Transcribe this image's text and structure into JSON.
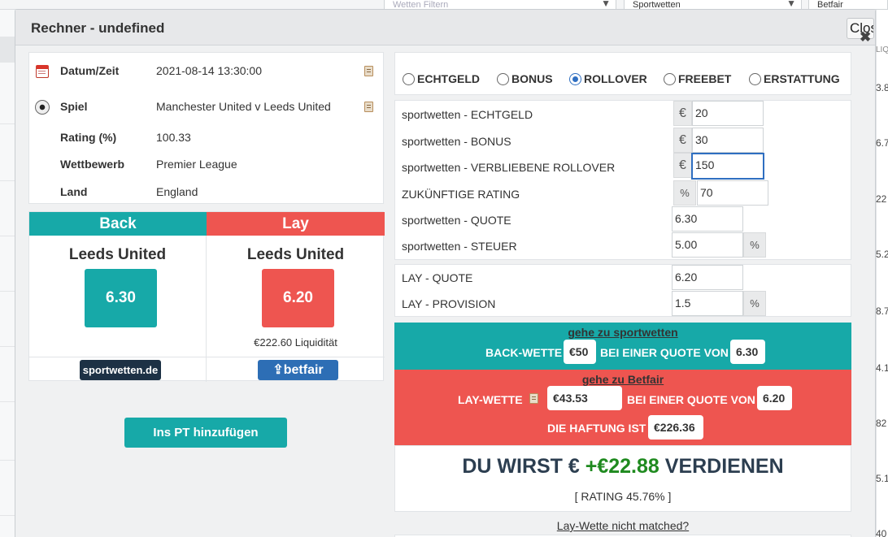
{
  "background": {
    "filter_placeholder": "Wetten Filtern",
    "sport_select": "Sportwetten",
    "right_select": "Betfair",
    "right_header": "LIQUI",
    "right_numbers": [
      "3.8",
      "6.7",
      "22",
      "5.2",
      "8.7",
      "4.1",
      "82",
      "5.1",
      "40"
    ]
  },
  "modal": {
    "title": "Rechner - undefined",
    "close_label": "Close"
  },
  "info": {
    "date_label": "Datum/Zeit",
    "date_value": "2021-08-14 13:30:00",
    "game_label": "Spiel",
    "game_value": "Manchester United v Leeds United",
    "rating_label": "Rating (%)",
    "rating_value": "100.33",
    "competition_label": "Wettbewerb",
    "competition_value": "Premier League",
    "country_label": "Land",
    "country_value": "England"
  },
  "back": {
    "header": "Back",
    "team": "Leeds United",
    "odds": "6.30",
    "bookmaker": "sportwetten.de"
  },
  "lay": {
    "header": "Lay",
    "team": "Leeds United",
    "odds": "6.20",
    "liquidity": "€222.60 Liquidität",
    "exchange": "betfair"
  },
  "add_button": "Ins PT hinzufügen",
  "bet_types": [
    {
      "label": "ECHTGELD",
      "selected": false
    },
    {
      "label": "BONUS",
      "selected": false
    },
    {
      "label": "ROLLOVER",
      "selected": true
    },
    {
      "label": "FREEBET",
      "selected": false
    },
    {
      "label": "ERSTATTUNG",
      "selected": false
    }
  ],
  "form": {
    "real_money_label": "sportwetten - ECHTGELD",
    "real_money_value": "20",
    "bonus_label": "sportwetten - BONUS",
    "bonus_value": "30",
    "rollover_label": "sportwetten - VERBLIEBENE ROLLOVER",
    "rollover_value": "150",
    "future_rating_label": "ZUKÜNFTIGE RATING",
    "future_rating_value": "70",
    "odds_label": "sportwetten - QUOTE",
    "odds_value": "6.30",
    "tax_label": "sportwetten - STEUER",
    "tax_value": "5.00",
    "lay_odds_label": "LAY - QUOTE",
    "lay_odds_value": "6.20",
    "commission_label": "LAY - PROVISION",
    "commission_value": "1.5",
    "currency_symbol": "€",
    "percent_symbol": "%"
  },
  "instructions": {
    "back_link": "gehe zu sportwetten",
    "back_bet_label": "BACK-WETTE",
    "back_stake": "€50",
    "at_odds_label": "BEI EINER QUOTE VON",
    "back_odds": "6.30",
    "lay_link": "gehe zu Betfair",
    "lay_bet_label": "LAY-WETTE",
    "lay_stake": "€43.53",
    "lay_odds": "6.20",
    "liability_label": "DIE HAFTUNG IST",
    "liability": "€226.36"
  },
  "result": {
    "prefix": "DU WIRST €",
    "amount": "+€22.88",
    "suffix": "VERDIENEN",
    "rating": "[ RATING 45.76% ]"
  },
  "not_matched_link": "Lay-Wette nicht matched?",
  "colors": {
    "back": "#17a9a8",
    "lay": "#ee5550",
    "profit": "#1f8a1f"
  }
}
